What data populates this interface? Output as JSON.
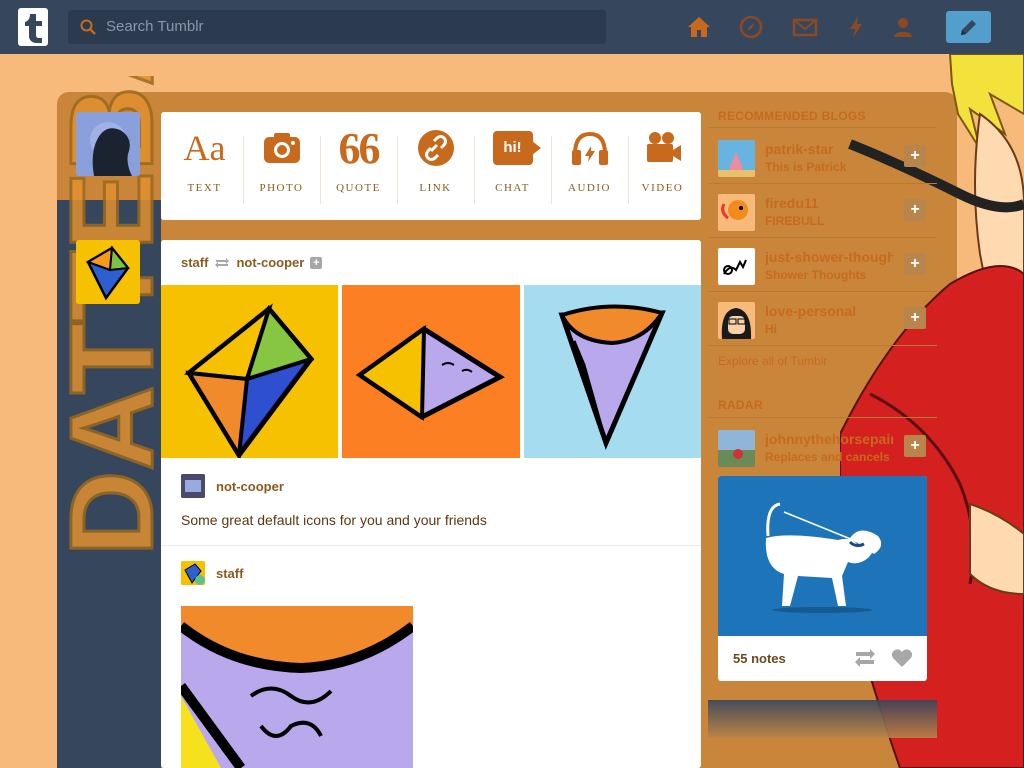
{
  "header": {
    "search_placeholder": "Search Tumblr",
    "nav_icons": [
      "home-icon",
      "explore-compass-icon",
      "inbox-icon",
      "activity-lightning-icon",
      "account-person-icon"
    ],
    "compose_icon": "pencil-icon"
  },
  "background": {
    "vertical_text": "DATTEBAYO"
  },
  "post_types": [
    {
      "label": "TEXT",
      "icon": "text-aa-icon",
      "glyph": "Aa"
    },
    {
      "label": "PHOTO",
      "icon": "camera-icon"
    },
    {
      "label": "QUOTE",
      "icon": "quote-icon",
      "glyph": "66"
    },
    {
      "label": "LINK",
      "icon": "link-icon"
    },
    {
      "label": "CHAT",
      "icon": "chat-bubble-icon",
      "glyph": "hi!"
    },
    {
      "label": "AUDIO",
      "icon": "headphones-icon"
    },
    {
      "label": "VIDEO",
      "icon": "video-camera-icon"
    }
  ],
  "post": {
    "reblogged_by": "staff",
    "reblogged_from": "not-cooper",
    "author": "not-cooper",
    "caption": "Some great default icons for you and your friends",
    "second_author": "staff"
  },
  "recommended": {
    "title": "RECOMMENDED BLOGS",
    "blogs": [
      {
        "name": "patrik-star",
        "sub": "This is Patrick"
      },
      {
        "name": "firedu11",
        "sub": "FIREBULL"
      },
      {
        "name": "just-shower-thoughts",
        "sub": "Shower Thoughts"
      },
      {
        "name": "love-personal",
        "sub": "Hi"
      }
    ],
    "explore": "Explore all of Tumblr"
  },
  "radar": {
    "title": "RADAR",
    "blog_name": "johnnythehorsepainter",
    "blog_sub": "Replaces and cancels",
    "notes": "55 notes"
  },
  "colors": {
    "topbar": "#36465d",
    "accent_brown": "#c76a1d",
    "background": "#f7ba7b"
  }
}
